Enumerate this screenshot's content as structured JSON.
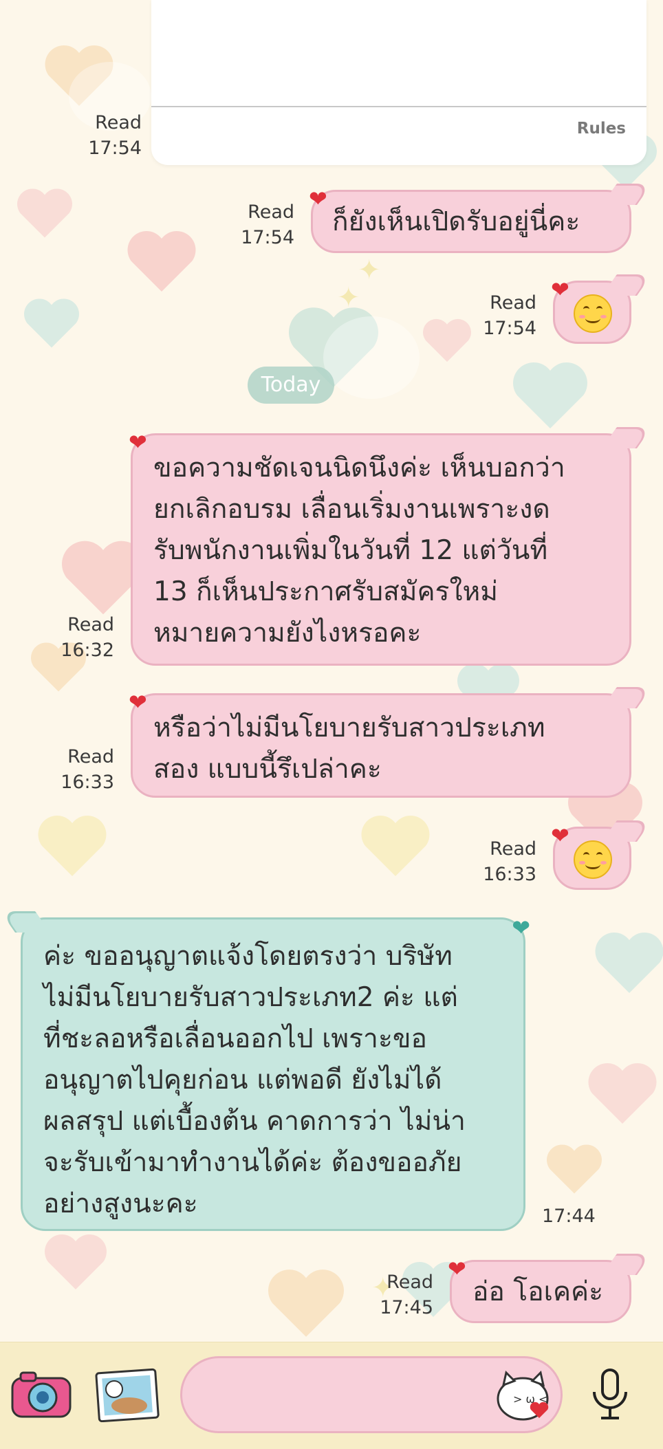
{
  "system_card": {
    "rules_label": "Rules"
  },
  "date_divider": "Today",
  "messages": [
    {
      "id": "m0",
      "status": "Read",
      "time": "17:54"
    },
    {
      "id": "m1",
      "text": "ก็ยังเห็นเปิดรับอยู่นี่คะ",
      "status": "Read",
      "time": "17:54"
    },
    {
      "id": "m2",
      "emoji": "smiling-face",
      "status": "Read",
      "time": "17:54"
    },
    {
      "id": "m3",
      "text": "ขอความชัดเจนนิดนึงค่ะ เห็นบอกว่า\nยกเลิกอบรม เลื่อนเริ่มงานเพราะงด\nรับพนักงานเพิ่มในวันที่ 12 แต่วันที่\n13 ก็เห็นประกาศรับสมัครใหม่\nหมายความยังไงหรอคะ",
      "status": "Read",
      "time": "16:32"
    },
    {
      "id": "m4",
      "text": "หรือว่าไม่มีนโยบายรับสาวประเภท\nสอง แบบนี้รึเปล่าคะ",
      "status": "Read",
      "time": "16:33"
    },
    {
      "id": "m5",
      "emoji": "smiling-face",
      "status": "Read",
      "time": "16:33"
    },
    {
      "id": "m6",
      "text": "ค่ะ ขออนุญาตแจ้งโดยตรงว่า บริษัท\nไม่มีนโยบายรับสาวประเภท2 ค่ะ แต่\nที่ชะลอหรือเลื่อนออกไป เพราะขอ\nอนุญาตไปคุยก่อน แต่พอดี ยังไม่ได้\nผลสรุป แต่เบื้องต้น คาดการว่า ไม่น่า\nจะรับเข้ามาทำงานได้ค่ะ ต้องขออภัย\nอย่างสูงนะคะ",
      "time": "17:44"
    },
    {
      "id": "m7",
      "text": "อ่อ โอเคค่ะ",
      "status": "Read",
      "time": "17:45"
    }
  ],
  "input": {
    "placeholder": ""
  },
  "colors": {
    "outgoing_bubble": "#f8d0da",
    "incoming_bubble": "#c7e7df",
    "background": "#fdf7ea",
    "bottom_bar": "#f7edc7"
  }
}
